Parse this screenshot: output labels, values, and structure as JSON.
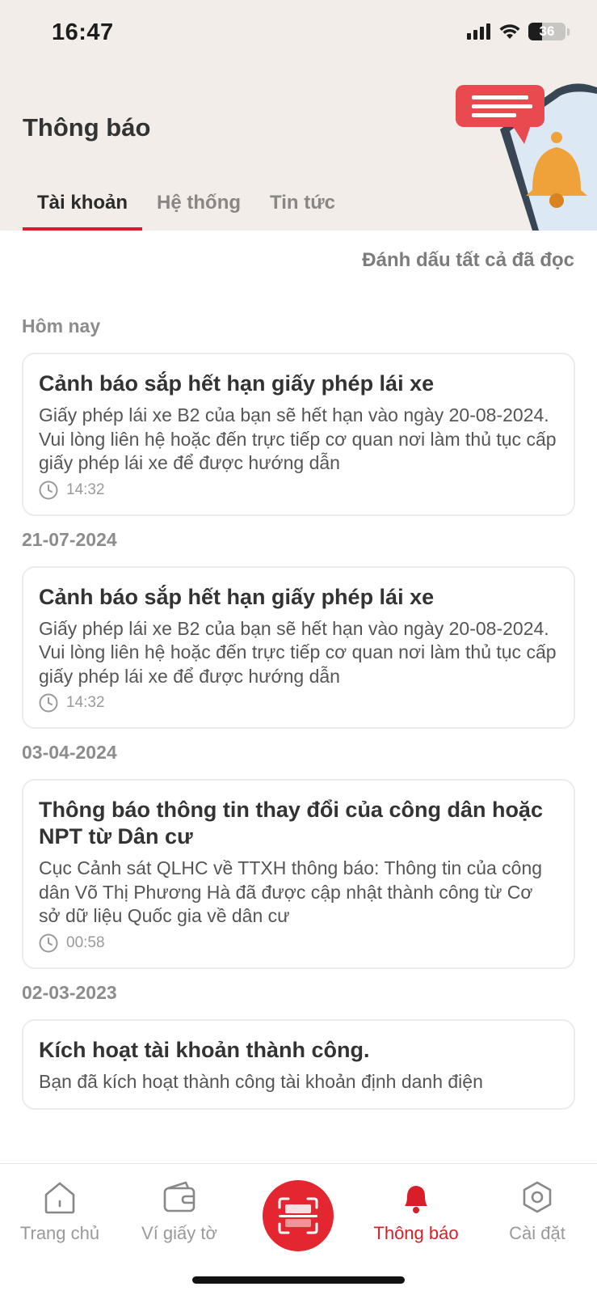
{
  "status_bar": {
    "time": "16:47",
    "battery": "36",
    "battery_level": 0.36
  },
  "header": {
    "title": "Thông báo"
  },
  "tabs": [
    {
      "label": "Tài khoản",
      "active": true
    },
    {
      "label": "Hệ thống",
      "active": false
    },
    {
      "label": "Tin tức",
      "active": false
    }
  ],
  "actions": {
    "mark_all_read": "Đánh dấu tất cả đã đọc"
  },
  "sections": [
    {
      "date": "Hôm nay",
      "items": [
        {
          "title": "Cảnh báo sắp hết hạn giấy phép lái xe",
          "body": "Giấy phép lái xe B2 của bạn sẽ hết hạn vào ngày 20-08-2024. Vui lòng liên hệ hoặc đến trực tiếp cơ quan nơi làm thủ tục cấp giấy phép lái xe để được hướng dẫn",
          "time": "14:32"
        }
      ]
    },
    {
      "date": "21-07-2024",
      "items": [
        {
          "title": "Cảnh báo sắp hết hạn giấy phép lái xe",
          "body": "Giấy phép lái xe B2 của bạn sẽ hết hạn vào ngày 20-08-2024. Vui lòng liên hệ hoặc đến trực tiếp cơ quan nơi làm thủ tục cấp giấy phép lái xe để được hướng dẫn",
          "time": "14:32"
        }
      ]
    },
    {
      "date": "03-04-2024",
      "items": [
        {
          "title": "Thông báo thông tin thay đổi của công dân hoặc NPT từ Dân cư",
          "body": "Cục Cảnh sát QLHC về TTXH thông báo: Thông tin của công dân Võ Thị Phương Hà đã được cập nhật thành công từ Cơ sở dữ liệu Quốc gia về dân cư",
          "time": "00:58"
        }
      ]
    },
    {
      "date": "02-03-2023",
      "items": [
        {
          "title": "Kích hoạt tài khoản thành công.",
          "body": "Bạn đã kích hoạt thành công tài khoản định danh điện",
          "time": ""
        }
      ]
    }
  ],
  "bottom_nav": {
    "home": "Trang chủ",
    "wallet": "Ví giấy tờ",
    "notifications": "Thông báo",
    "settings": "Cài đặt"
  },
  "colors": {
    "accent": "#d81e28",
    "header_bg": "#f2ede8"
  },
  "icons": [
    "signal-icon",
    "wifi-icon",
    "battery-icon",
    "clock-icon",
    "home-icon",
    "wallet-icon",
    "scan-icon",
    "bell-icon",
    "settings-icon"
  ]
}
